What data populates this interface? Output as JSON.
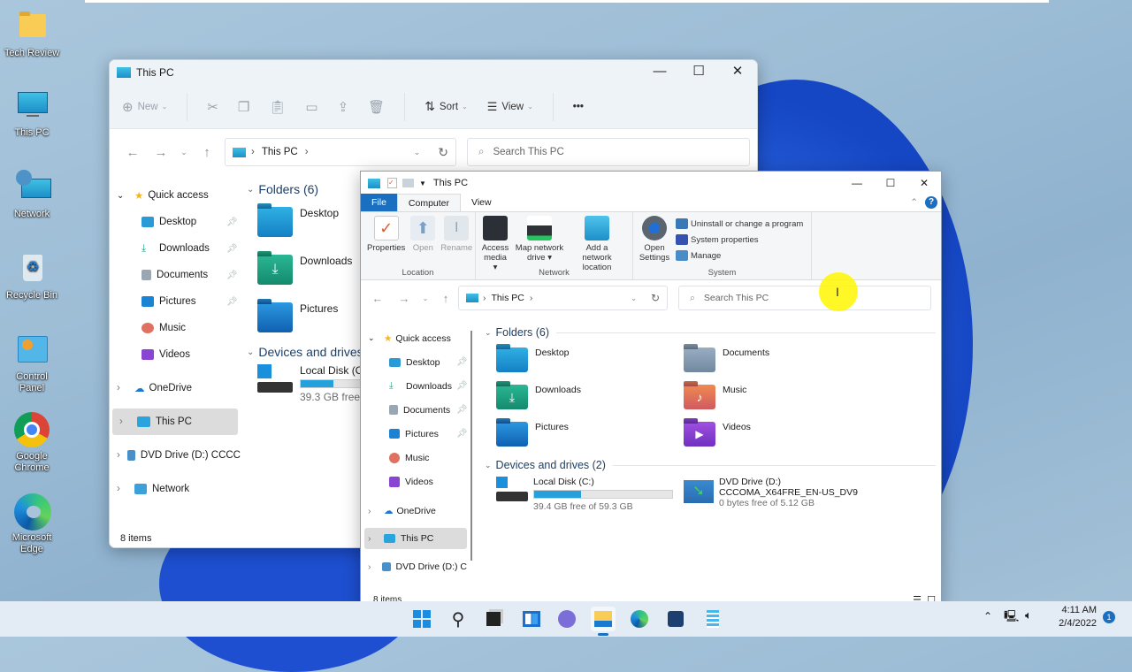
{
  "desktop": {
    "icons": [
      {
        "label": "Tech Review",
        "icon": "folder-icon"
      },
      {
        "label": "This PC",
        "icon": "computer-icon"
      },
      {
        "label": "Network",
        "icon": "network-icon"
      },
      {
        "label": "Recycle Bin",
        "icon": "recycle-bin-icon"
      },
      {
        "label": "Control Panel",
        "icon": "control-panel-icon"
      },
      {
        "label": "Google Chrome",
        "icon": "chrome-icon"
      },
      {
        "label": "Microsoft Edge",
        "icon": "edge-icon"
      }
    ]
  },
  "window_back": {
    "title": "This PC",
    "controls": {
      "minimize": "—",
      "maximize": "☐",
      "close": "✕"
    },
    "commands": {
      "new": "New",
      "sort": "Sort",
      "view": "View",
      "more": "•••"
    },
    "address": {
      "location": "This PC"
    },
    "search_placeholder": "Search This PC",
    "nav": {
      "quick_access": "Quick access",
      "quick_items": [
        "Desktop",
        "Downloads",
        "Documents",
        "Pictures",
        "Music",
        "Videos"
      ],
      "roots": [
        "OneDrive",
        "This PC",
        "DVD Drive (D:) CCCC",
        "Network"
      ]
    },
    "folders_header": "Folders (6)",
    "folders": [
      "Desktop",
      "Downloads",
      "Pictures"
    ],
    "devices_header": "Devices and drives",
    "local_disk": {
      "name": "Local Disk (C:",
      "free": "39.3 GB free o",
      "used_fraction": 0.34
    },
    "status": "8 items"
  },
  "window_front": {
    "title": "This PC",
    "controls": {
      "minimize": "—",
      "maximize": "☐",
      "close": "✕"
    },
    "tabs": [
      "File",
      "Computer",
      "View"
    ],
    "ribbon": {
      "location": {
        "label": "Location",
        "buttons": [
          "Properties",
          "Open",
          "Rename"
        ]
      },
      "network": {
        "label": "Network",
        "buttons": [
          "Access media ▾",
          "Map network drive ▾",
          "Add a network location"
        ]
      },
      "system": {
        "label": "System",
        "open_settings": "Open Settings",
        "items": [
          "Uninstall or change a program",
          "System properties",
          "Manage"
        ]
      }
    },
    "address": {
      "location": "This PC"
    },
    "search_placeholder": "Search This PC",
    "nav": {
      "quick_access": "Quick access",
      "quick_items": [
        "Desktop",
        "Downloads",
        "Documents",
        "Pictures",
        "Music",
        "Videos"
      ],
      "roots": [
        "OneDrive",
        "This PC",
        "DVD Drive (D:) C"
      ]
    },
    "folders_header": "Folders (6)",
    "folders": [
      "Desktop",
      "Documents",
      "Downloads",
      "Music",
      "Pictures",
      "Videos"
    ],
    "devices_header": "Devices and drives (2)",
    "drives": [
      {
        "name": "Local Disk (C:)",
        "free": "39.4 GB free of 59.3 GB",
        "used_fraction": 0.34
      },
      {
        "name": "DVD Drive (D:)",
        "label": "CCCOMA_X64FRE_EN-US_DV9",
        "free": "0 bytes free of 5.12 GB"
      }
    ],
    "status": "8 items"
  },
  "taskbar": {
    "apps": [
      "start",
      "search",
      "task-view",
      "widgets",
      "teams-chat",
      "file-explorer",
      "edge",
      "store",
      "notepad"
    ],
    "time": "4:11 AM",
    "date": "2/4/2022",
    "notifications": "1"
  }
}
